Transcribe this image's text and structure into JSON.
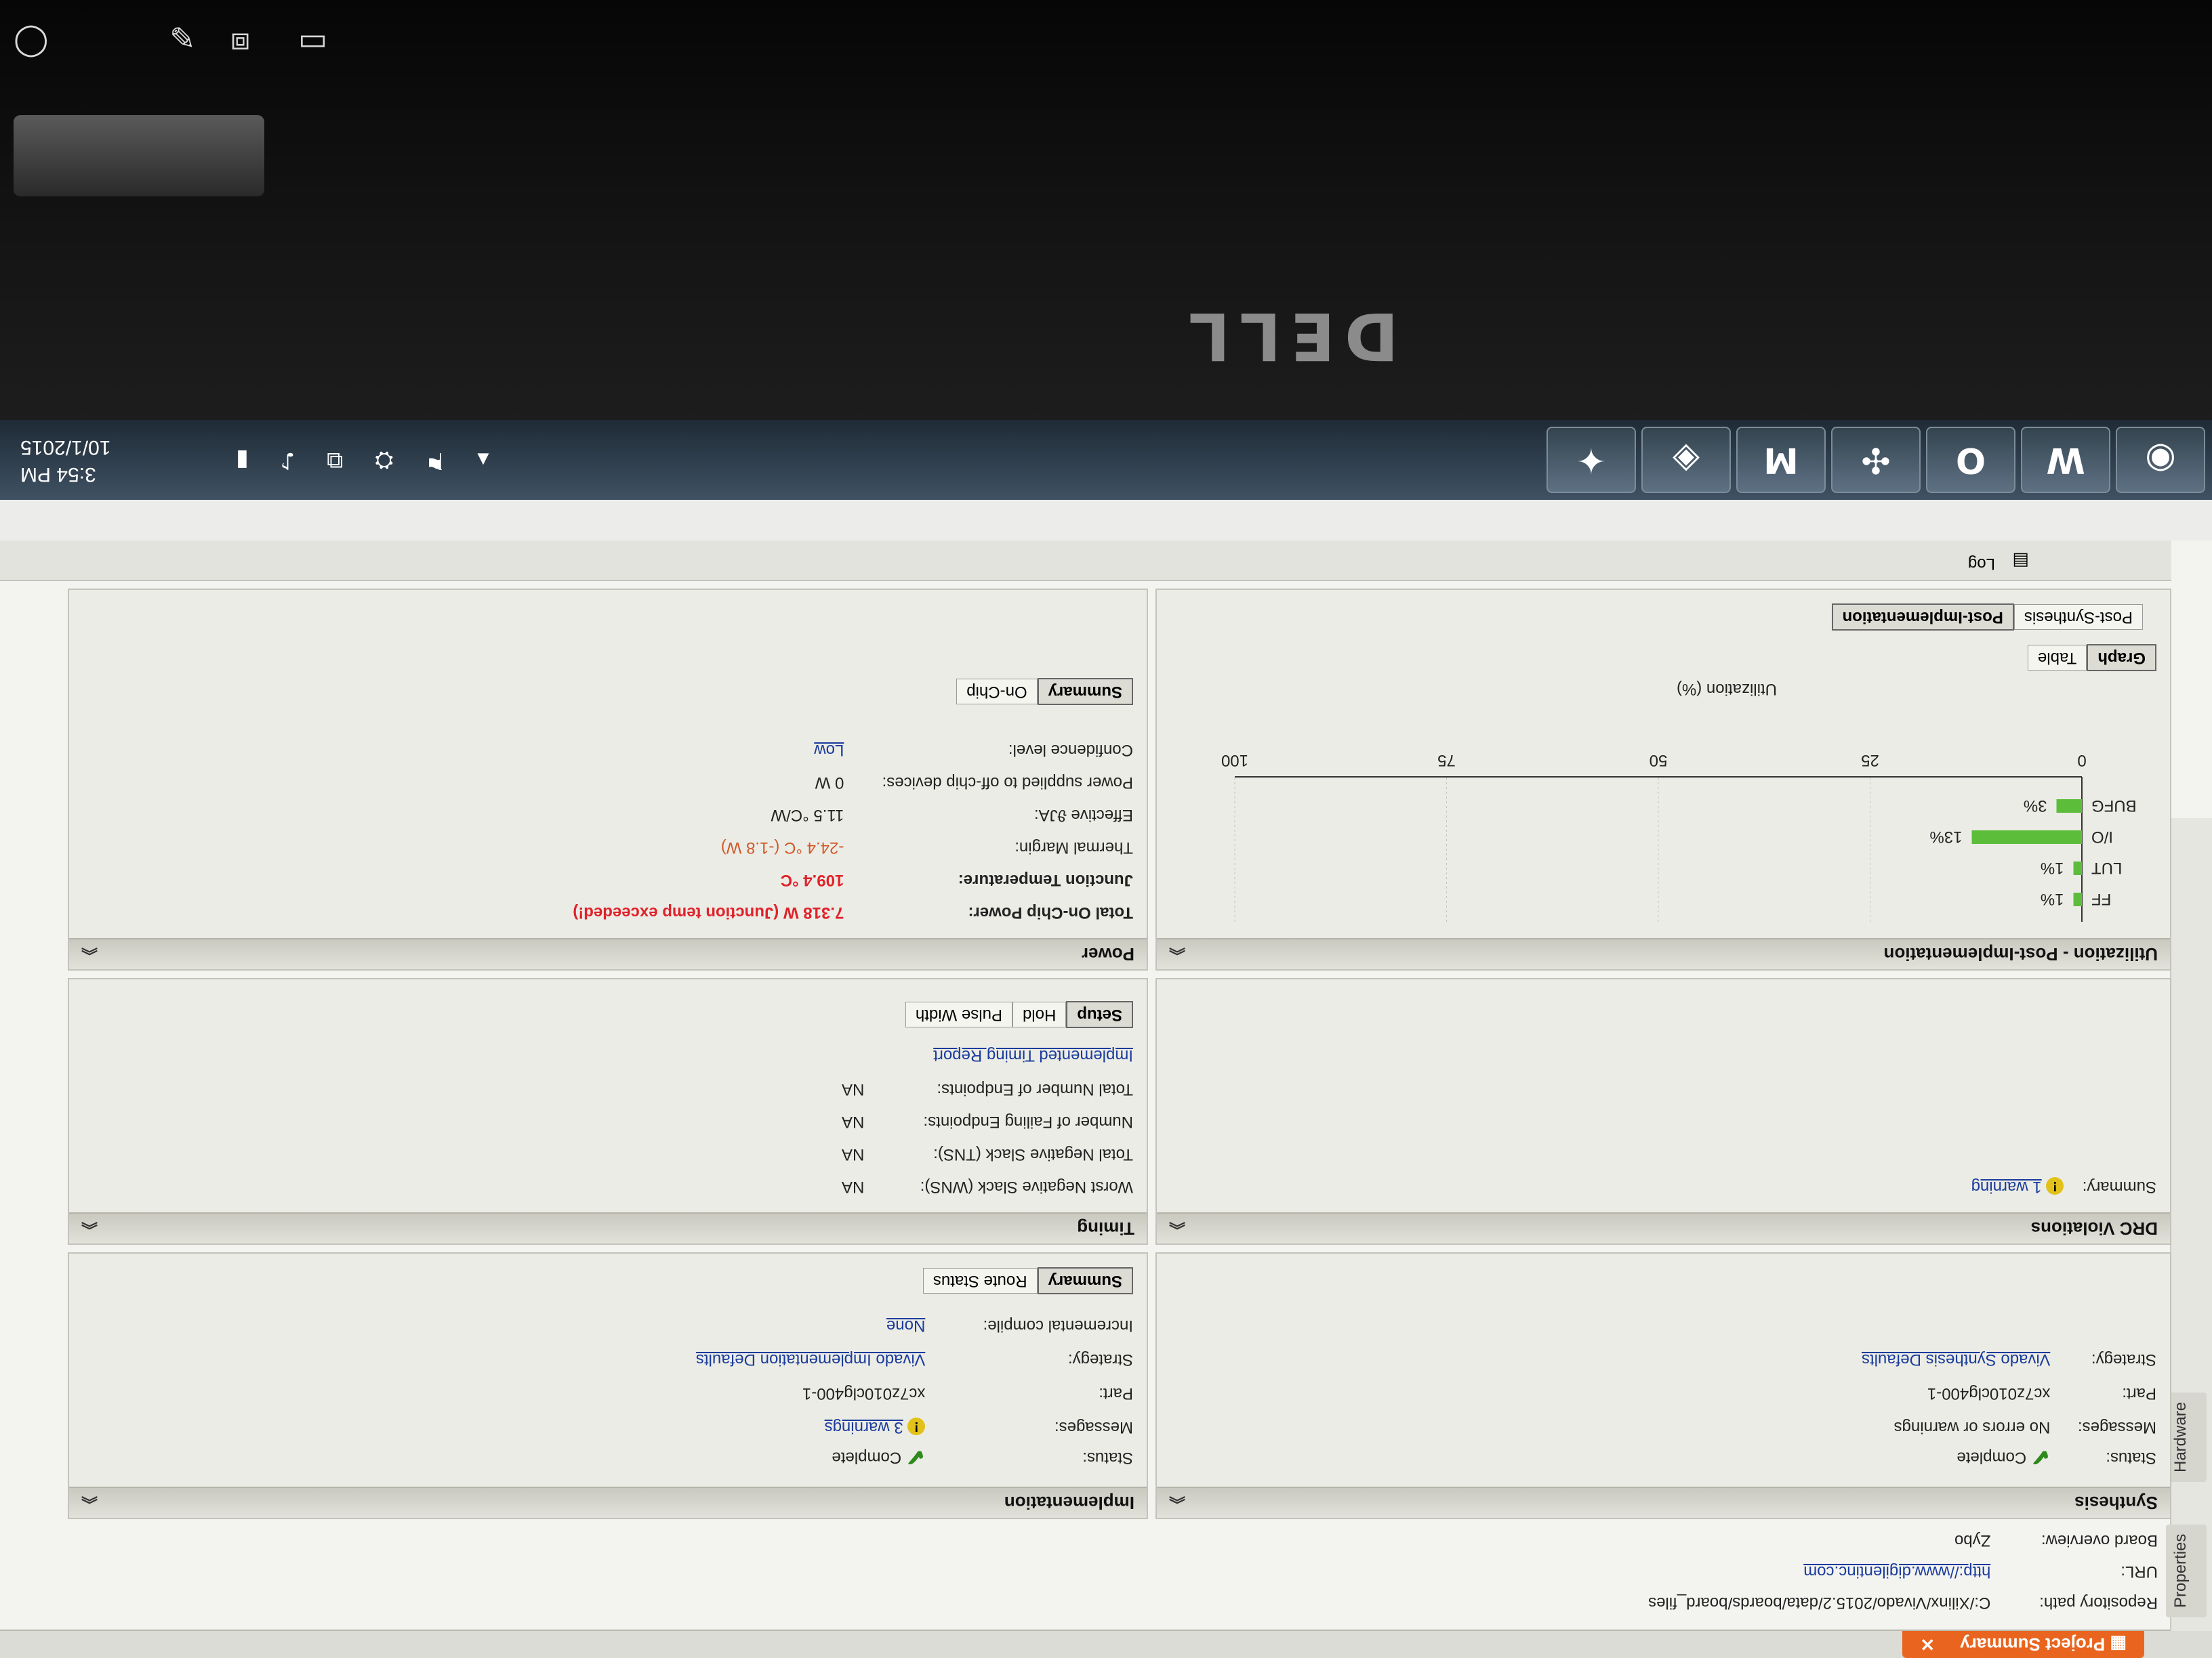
{
  "device": {
    "brand_logo": "DELL"
  },
  "tabs": {
    "active": "Project Summary",
    "side": [
      "Properties",
      "Hardware"
    ]
  },
  "project": {
    "rows": [
      {
        "label": "Repository path:",
        "value": "C:/Xilinx/Vivado/2015.2/data/boards/board_files"
      },
      {
        "label": "URL:",
        "value": "http://www.digilentinc.com"
      },
      {
        "label": "Board overview:",
        "value": "Zybo"
      }
    ]
  },
  "synthesis": {
    "title": "Synthesis",
    "status_label": "Status:",
    "status": "Complete",
    "messages_label": "Messages:",
    "messages": "No errors or warnings",
    "part_label": "Part:",
    "part": "xc7z010clg400-1",
    "strategy_label": "Strategy:",
    "strategy": "Vivado Synthesis Defaults"
  },
  "implementation": {
    "title": "Implementation",
    "status_label": "Status:",
    "status": "Complete",
    "messages_label": "Messages:",
    "messages": "3 warnings",
    "part_label": "Part:",
    "part": "xc7z010clg400-1",
    "strategy_label": "Strategy:",
    "strategy": "Vivado Implementation Defaults",
    "incremental_label": "Incremental compile:",
    "incremental": "None",
    "buttons": [
      "Summary",
      "Route Status"
    ]
  },
  "drc": {
    "title": "DRC Violations",
    "summary_label": "Summary:",
    "summary": "1 warning"
  },
  "timing": {
    "title": "Timing",
    "rows": [
      {
        "label": "Worst Negative Slack (WNS):",
        "value": "NA"
      },
      {
        "label": "Total Negative Slack (TNS):",
        "value": "NA"
      },
      {
        "label": "Number of Failing Endpoints:",
        "value": "NA"
      },
      {
        "label": "Total Number of Endpoints:",
        "value": "NA"
      }
    ],
    "report_link": "Implemented Timing Report",
    "buttons": [
      "Setup",
      "Hold",
      "Pulse Width"
    ]
  },
  "utilization": {
    "title": "Utilization - Post-Implementation",
    "xlabel": "Utilization (%)",
    "buttons": [
      "Graph",
      "Table"
    ],
    "subtabs": [
      "Post-Synthesis",
      "Post-Implementation"
    ]
  },
  "chart_data": {
    "type": "bar",
    "categories": [
      "FF",
      "LUT",
      "I/O",
      "BUFG"
    ],
    "values": [
      1,
      1,
      13,
      3
    ],
    "value_labels": [
      "1%",
      "1%",
      "13%",
      "3%"
    ],
    "xlabel": "Utilization (%)",
    "xlim": [
      0,
      100
    ],
    "ticks": [
      "0",
      "25",
      "50",
      "75",
      "100"
    ],
    "orientation": "horizontal"
  },
  "power": {
    "title": "Power",
    "total_label": "Total On-Chip Power:",
    "total": "7.318 W (Junction temp exceeded!)",
    "junction_label": "Junction Temperature:",
    "junction": "109.4 °C",
    "margin_label": "Thermal Margin:",
    "margin": "-24.4 °C (-1.8 W)",
    "theta_label": "Effective ϑJA:",
    "theta": "11.5 °C/W",
    "offchip_label": "Power supplied to off-chip devices:",
    "offchip": "0 W",
    "confidence_label": "Confidence level:",
    "confidence": "Low",
    "buttons": [
      "Summary",
      "On-Chip"
    ]
  },
  "bottom": {
    "log_tab": "Log"
  },
  "tray": {
    "time": "3:54 PM",
    "date": "10/1/2015"
  },
  "colors": {
    "accent": "#e9651f",
    "bar": "#5cbd3a",
    "error": "#e0222a"
  }
}
